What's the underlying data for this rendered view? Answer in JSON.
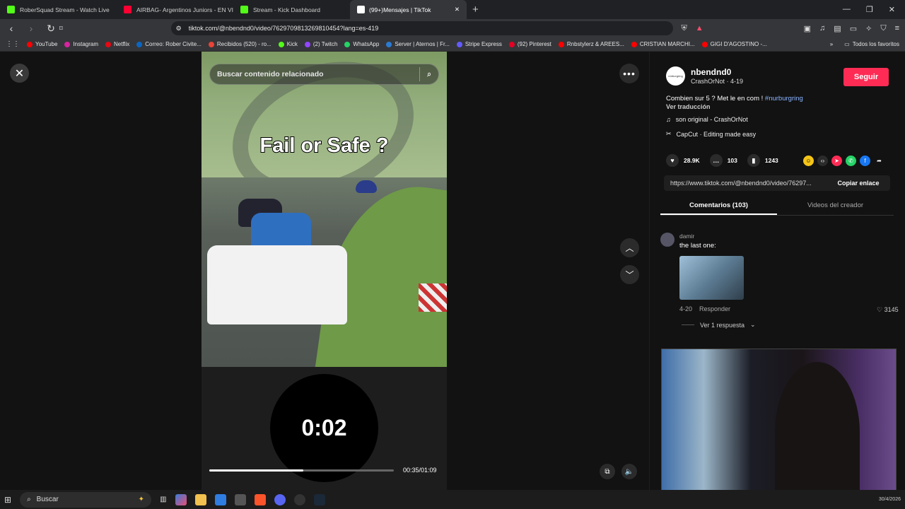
{
  "browser": {
    "tabs": [
      {
        "label": "RoberSquad Stream - Watch Live",
        "color": "#53fc18"
      },
      {
        "label": "AIRBAG- Argentinos Juniors - EN VIVO",
        "color": "#ff0033"
      },
      {
        "label": "Stream - Kick Dashboard",
        "color": "#53fc18"
      },
      {
        "label": "(99+)Mensajes | TikTok",
        "color": "#ffffff",
        "active": true
      }
    ],
    "new_tab": "+",
    "url": "tiktok.com/@nbendnd0/video/7629709813269810454?lang=es-419",
    "bookmarks": [
      "YouTube",
      "Instagram",
      "Netflix",
      "Correo: Rober Civite...",
      "Recibidos (520) - ro...",
      "Kick",
      "(2) Twitch",
      "WhatsApp",
      "Server | Aternos | Fr...",
      "Stripe Express",
      "(92) Pinterest",
      "Rnbstylerz & AREES...",
      "CRISTIAN MARCHI...",
      "GIGI D'AGOSTINO -..."
    ],
    "all_bookmarks": "Todos los favoritos"
  },
  "video": {
    "search_placeholder": "Buscar contenido relacionado",
    "overlay_title": "Fail or Safe ?",
    "timer": "0:02",
    "time_display": "00:35/01:09",
    "progress": 0.51
  },
  "sidebar": {
    "username": "nbendnd0",
    "subline": "CrashOrNot · 4-19",
    "avatar_text": "nürburgring",
    "follow": "Seguir",
    "description": "Combien sur 5 ? Met le en com ! ",
    "hashtag": "#nurburgring",
    "translate": "Ver traducción",
    "music": "son original - CrashOrNot",
    "capcut": "CapCut · Editing made easy",
    "likes": "28.9K",
    "comments": "103",
    "saves": "1243",
    "link": "https://www.tiktok.com/@nbendnd0/video/76297...",
    "copy_link": "Copiar enlace",
    "tab_comments": "Comentarios (103)",
    "tab_videos": "Videos del creador"
  },
  "comment": {
    "user": "damir",
    "text": "the last one:",
    "date": "4-20",
    "reply": "Responder",
    "likes": "3145",
    "view_replies": "Ver 1 respuesta"
  },
  "taskbar": {
    "search": "Buscar",
    "date": "30/4/2026"
  }
}
